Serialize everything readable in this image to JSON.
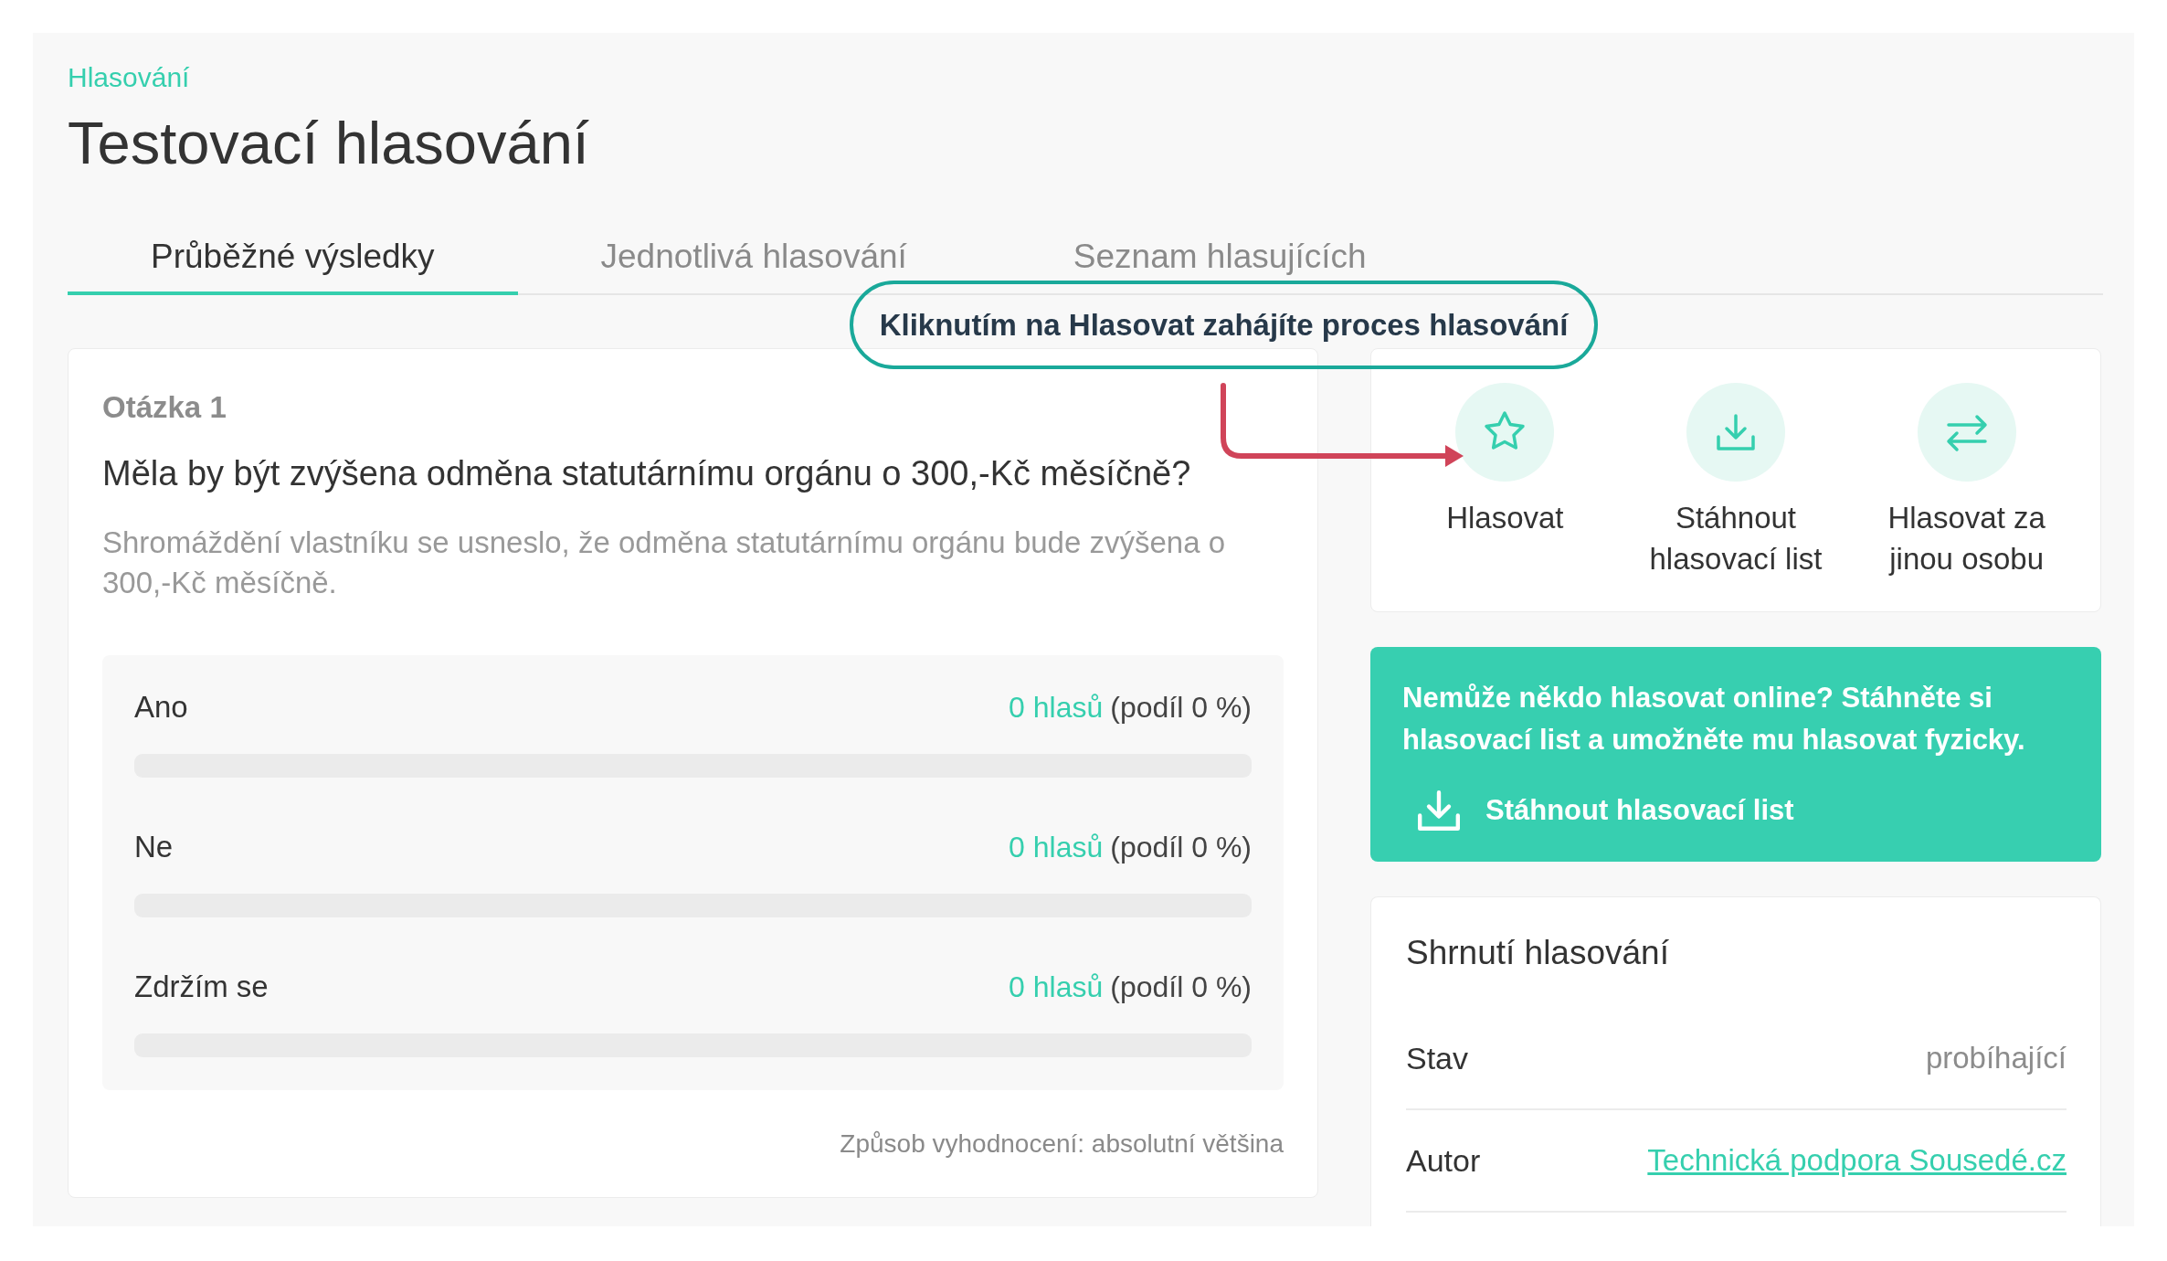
{
  "breadcrumb": "Hlasování",
  "title": "Testovací hlasování",
  "tabs": [
    {
      "label": "Průběžné výsledky",
      "selected": true
    },
    {
      "label": "Jednotlivá hlasování",
      "selected": false
    },
    {
      "label": "Seznam hlasujících",
      "selected": false
    }
  ],
  "callout": "Kliknutím na Hlasovat zahájíte proces hlasování",
  "question": {
    "number": "Otázka 1",
    "text": "Měla by být zvýšena odměna statutárnímu orgánu o 300,-Kč měsíčně?",
    "description": "Shromáždění vlastníku se usneslo, že odměna statutárnímu orgánu bude zvýšena o 300,-Kč měsíčně.",
    "options": [
      {
        "label": "Ano",
        "votes": "0 hlasů",
        "share": "(podíl 0 %)"
      },
      {
        "label": "Ne",
        "votes": "0 hlasů",
        "share": "(podíl 0 %)"
      },
      {
        "label": "Zdržím se",
        "votes": "0 hlasů",
        "share": "(podíl 0 %)"
      }
    ],
    "evaluation": "Způsob vyhodnocení: absolutní většina"
  },
  "actions": [
    {
      "kind": "vote",
      "label": "Hlasovat"
    },
    {
      "kind": "download",
      "label": "Stáhnout hlasovací list"
    },
    {
      "kind": "proxy",
      "label": "Hlasovat za jinou osobu"
    }
  ],
  "notice": {
    "text": "Nemůže někdo hlasovat online? Stáhněte si hlasovací list a umožněte mu hlasovat fyzicky.",
    "link": "Stáhnout hlasovací list"
  },
  "summary": {
    "title": "Shrnutí hlasování",
    "rows": [
      {
        "kind": "text",
        "label": "Stav",
        "value": "probíhající"
      },
      {
        "kind": "link",
        "label": "Autor",
        "value": "Technická podpora Sousedé.cz"
      }
    ]
  }
}
